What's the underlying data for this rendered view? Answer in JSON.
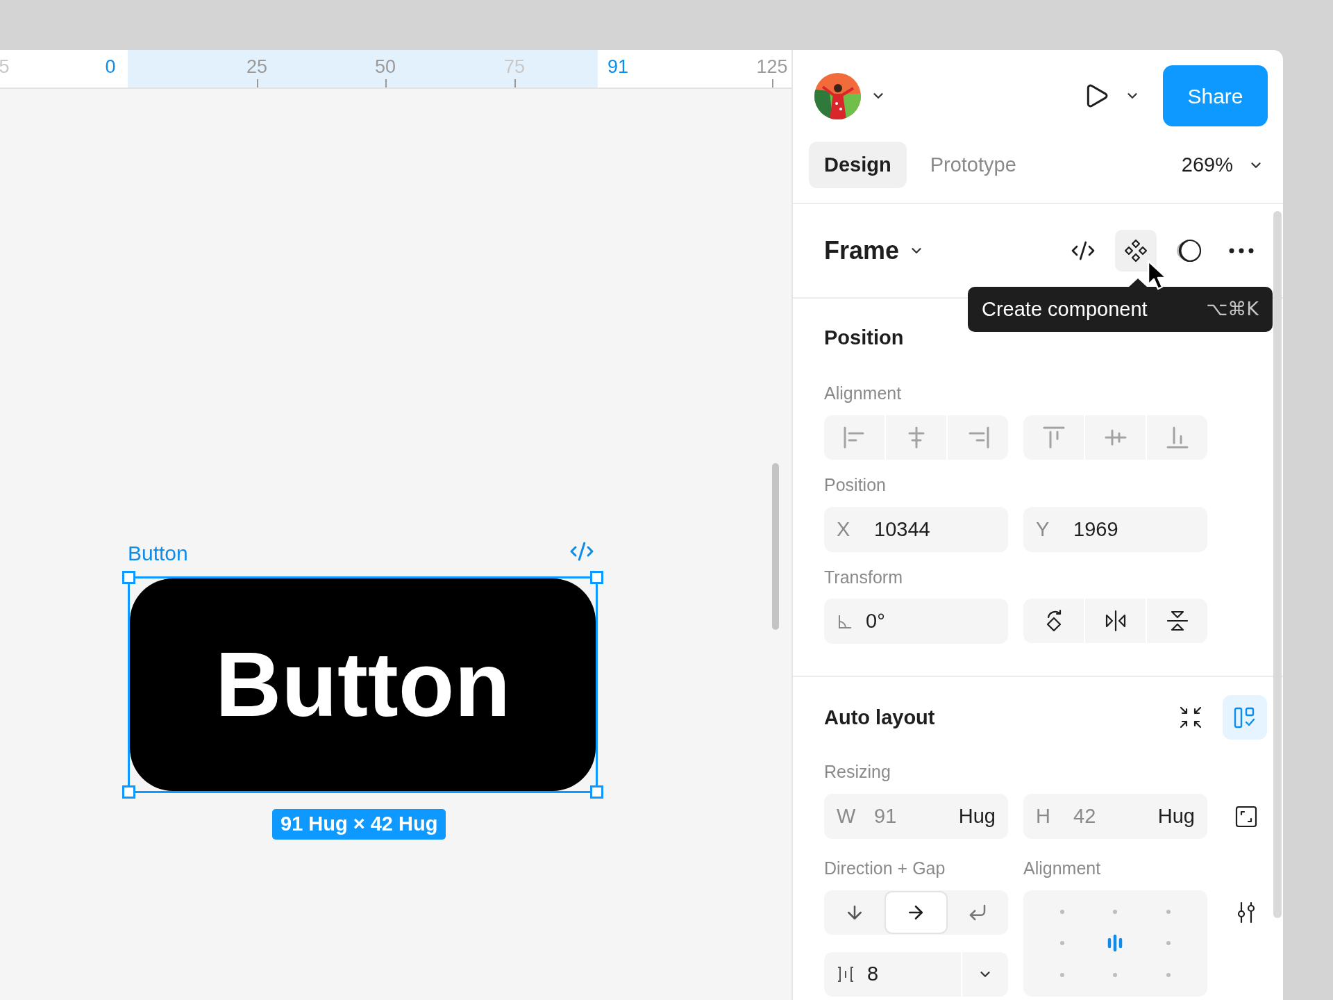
{
  "ruler": {
    "marks": [
      {
        "label": "5",
        "kind": "faded"
      },
      {
        "label": "0",
        "kind": "bound"
      },
      {
        "label": "25",
        "kind": "normal"
      },
      {
        "label": "50",
        "kind": "normal"
      },
      {
        "label": "75",
        "kind": "faded"
      },
      {
        "label": "91",
        "kind": "bound"
      },
      {
        "label": "125",
        "kind": "normal"
      }
    ]
  },
  "canvas": {
    "frame_label": "Button",
    "button_text": "Button",
    "size_badge": "91 Hug × 42 Hug"
  },
  "header": {
    "share": "Share"
  },
  "tabs": [
    {
      "label": "Design",
      "selected": true
    },
    {
      "label": "Prototype",
      "selected": false
    }
  ],
  "zoom": "269%",
  "layer": {
    "title": "Frame"
  },
  "tooltip": {
    "text": "Create component",
    "shortcut": "⌥⌘K"
  },
  "position": {
    "title": "Position",
    "alignment_label": "Alignment",
    "position_label": "Position",
    "x": {
      "label": "X",
      "value": "10344"
    },
    "y": {
      "label": "Y",
      "value": "1969"
    },
    "transform_label": "Transform",
    "rotation": "0°"
  },
  "auto_layout": {
    "title": "Auto layout",
    "resizing_label": "Resizing",
    "width": {
      "label": "W",
      "value": "91",
      "mode": "Hug"
    },
    "height": {
      "label": "H",
      "value": "42",
      "mode": "Hug"
    },
    "direction_label": "Direction + Gap",
    "alignment_label": "Alignment",
    "directions": [
      {
        "kind": "vertical",
        "selected": false
      },
      {
        "kind": "horizontal",
        "selected": true
      },
      {
        "kind": "wrap",
        "selected": false
      }
    ],
    "gap": "8",
    "alignment_cells": [
      {
        "selected": false
      },
      {
        "selected": false
      },
      {
        "selected": false
      },
      {
        "selected": false
      },
      {
        "selected": true
      },
      {
        "selected": false
      },
      {
        "selected": false
      },
      {
        "selected": false
      },
      {
        "selected": false
      }
    ]
  }
}
